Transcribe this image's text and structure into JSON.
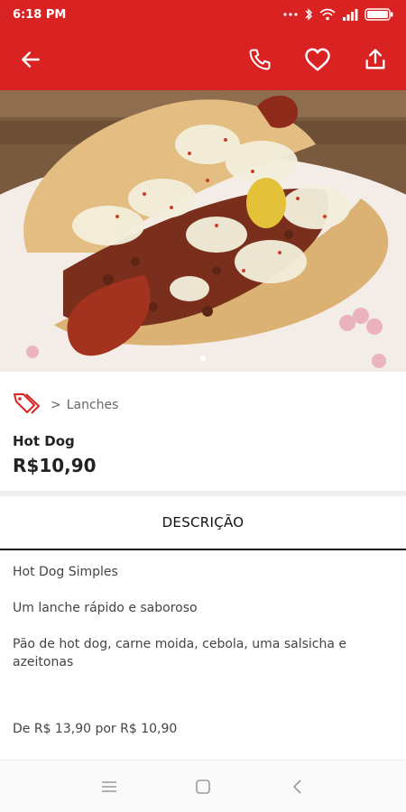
{
  "status_bar": {
    "time": "6:18 PM"
  },
  "app_bar": {
    "back_icon": "arrow-left-icon",
    "actions": [
      "phone-icon",
      "heart-icon",
      "share-icon"
    ],
    "background": "#d92323"
  },
  "product": {
    "image_alt": "hot-dog photo",
    "category_icon": "tags-icon",
    "breadcrumb_separator": ">",
    "category": "Lanches",
    "name": "Hot Dog",
    "price": "R$10,90"
  },
  "tabs": {
    "description": "DESCRIÇÃO"
  },
  "description": {
    "line1": "Hot Dog Simples",
    "line2": "Um lanche rápido e saboroso",
    "line3": "Pão de hot dog, carne moida, cebola, uma salsicha e azeitonas",
    "offer": "De R$ 13,90 por R$ 10,90"
  },
  "colors": {
    "accent": "#d92323",
    "text_muted": "#666666"
  }
}
